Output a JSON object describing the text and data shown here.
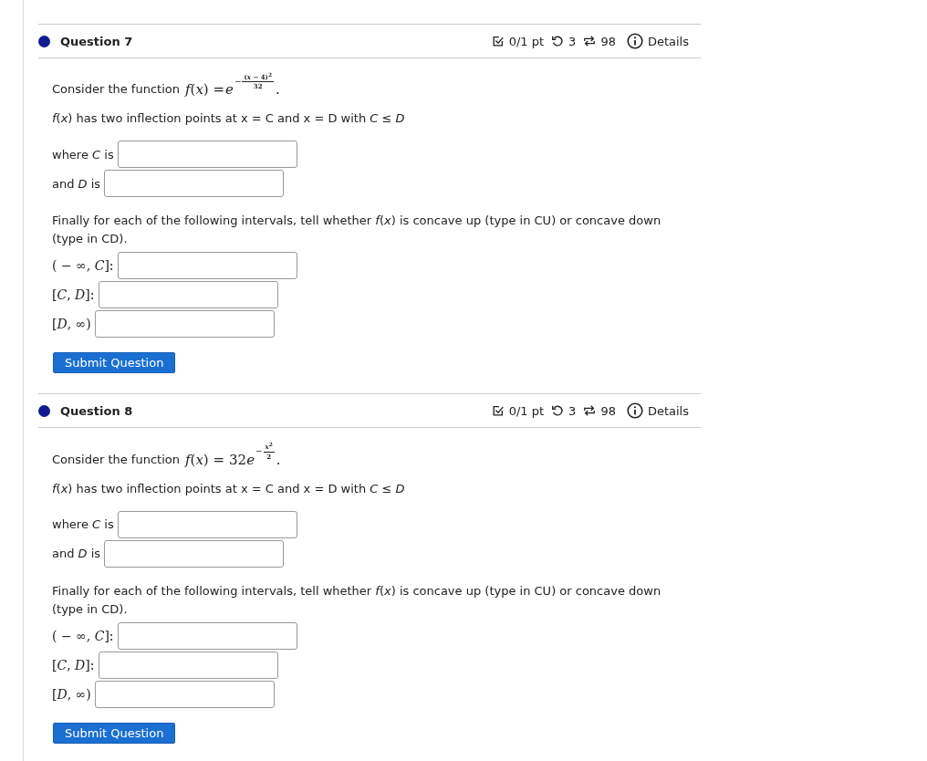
{
  "questions": [
    {
      "title": "Question 7",
      "score": "0/1 pt",
      "retries": "3",
      "attempts": "98",
      "details": "Details",
      "intro": "Consider the function",
      "formula": {
        "lhs": "*f*(*x*) =",
        "base": "e",
        "sign": "−",
        "numerator": "(*x* − 4)$^{2}$",
        "denominator": "32",
        "end": "."
      },
      "statement": "*f*(*x*) has two inflection points at x = C and x = D with *C* ≤ *D*",
      "fields": [
        {
          "label": "where *C* is"
        },
        {
          "label": "and *D* is"
        }
      ],
      "instructions": "Finally for each of the following intervals, tell whether *f*(*x*) is concave up (type in CU) or concave down (type in CD).",
      "interval_fields": [
        {
          "label": "( − ∞, *C*]:"
        },
        {
          "label": "[*C*, *D*]:"
        },
        {
          "label": "[*D*, ∞)"
        }
      ],
      "submit": "Submit Question"
    },
    {
      "title": "Question 8",
      "score": "0/1 pt",
      "retries": "3",
      "attempts": "98",
      "details": "Details",
      "intro": "Consider the function",
      "formula": {
        "lhs": "*f*(*x*) =",
        "coefficient": "32",
        "base": "e",
        "sign": "−",
        "numerator": "*x*$^{2}$",
        "denominator": "2",
        "end": "."
      },
      "statement": "*f*(*x*) has two inflection points at x = C and x = D with *C* ≤ *D*",
      "fields": [
        {
          "label": "where *C* is"
        },
        {
          "label": "and *D* is"
        }
      ],
      "instructions": "Finally for each of the following intervals, tell whether *f*(*x*) is concave up (type in CU) or concave down (type in CD).",
      "interval_fields": [
        {
          "label": "( − ∞, *C*]:"
        },
        {
          "label": "[*C*, *D*]:"
        },
        {
          "label": "[*D*, ∞)"
        }
      ],
      "submit": "Submit Question"
    }
  ]
}
